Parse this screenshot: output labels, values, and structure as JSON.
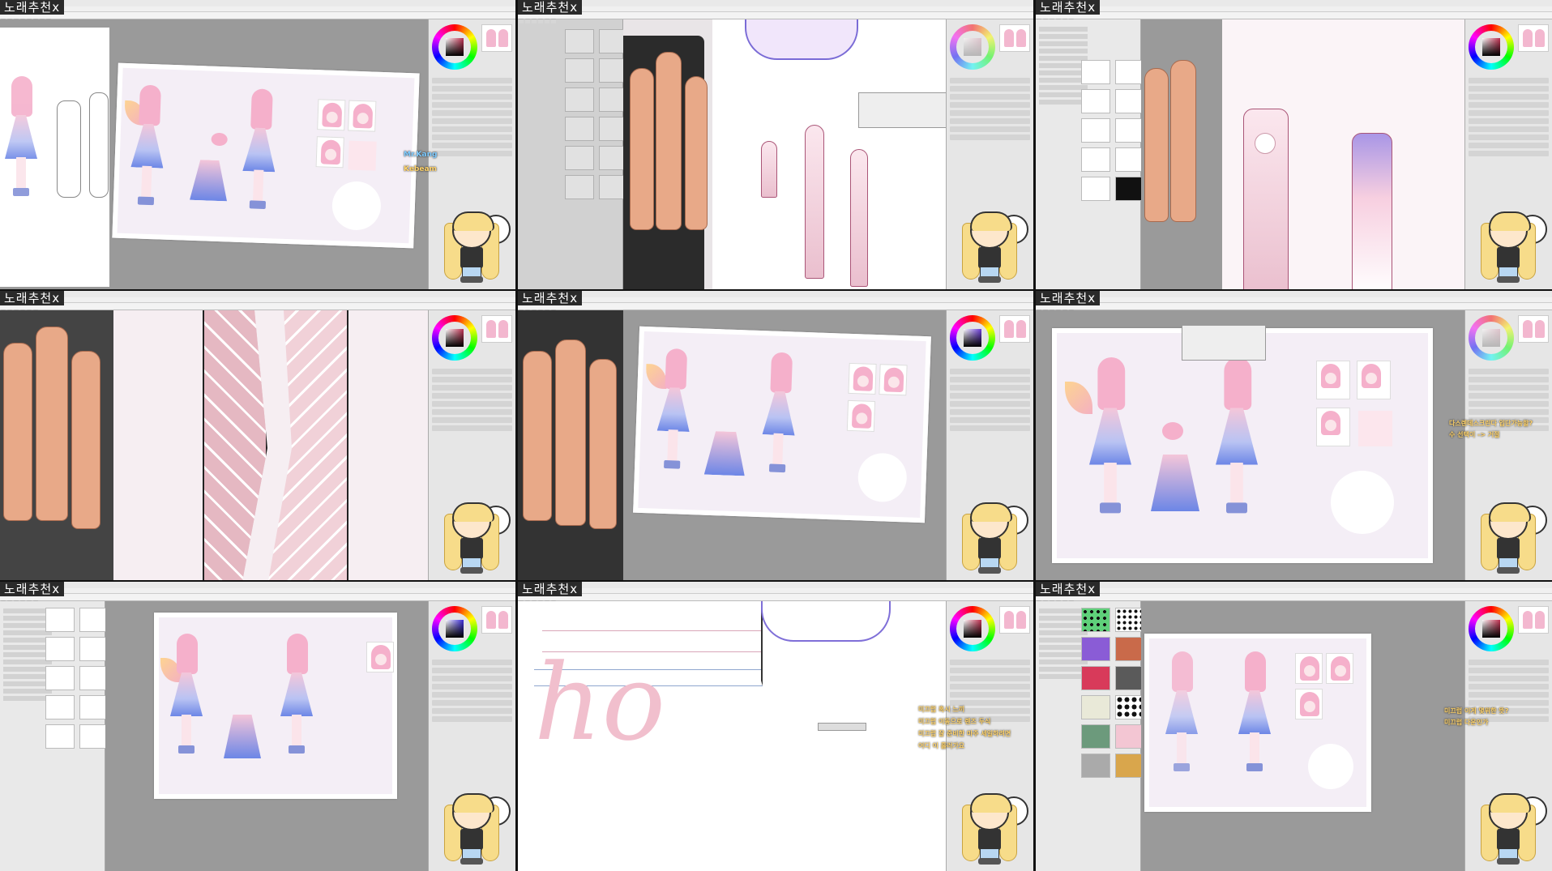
{
  "thumbnails": [
    {
      "tag": "노래추천x",
      "chat": [
        {
          "name": "Mr.Kang",
          "color": "#7ecbff"
        },
        {
          "name": "Kebeam",
          "color": "#ffd36a"
        }
      ]
    },
    {
      "tag": "노래추천x",
      "chat": []
    },
    {
      "tag": "노래추천x",
      "chat": []
    },
    {
      "tag": "노래추천x",
      "chat": []
    },
    {
      "tag": "노래추천x",
      "chat": []
    },
    {
      "tag": "노래추천x",
      "chat": [
        {
          "text": "다스렌데스크린다 입단가능할?",
          "color": "#ffd36a"
        },
        {
          "text": "수 선택이 -> 거절",
          "color": "#ffd36a"
        }
      ]
    },
    {
      "tag": "노래추천x",
      "chat": []
    },
    {
      "tag": "노래추천x",
      "chat": [
        {
          "text": "미끄럽 혹시 느끼",
          "color": "#ffd36a"
        },
        {
          "text": "미끄럽 이동으로 렌즈 두식",
          "color": "#ffd36a"
        },
        {
          "text": "미끄럽 잘 준비한 마주 세일하려면",
          "color": "#ffd36a"
        },
        {
          "text": "어디 이 흘러가요",
          "color": "#ffd36a"
        }
      ]
    },
    {
      "tag": "노래추천x",
      "chat": [
        {
          "text": "미끄럽 이게 몇위한 뜻?",
          "color": "#ffd36a"
        },
        {
          "text": "미끄럽 다운인가",
          "color": "#ffd36a"
        }
      ]
    }
  ],
  "icons": {
    "mascot": "blonde-chibi-mascot-icon",
    "color_wheel": "color-wheel-icon"
  }
}
